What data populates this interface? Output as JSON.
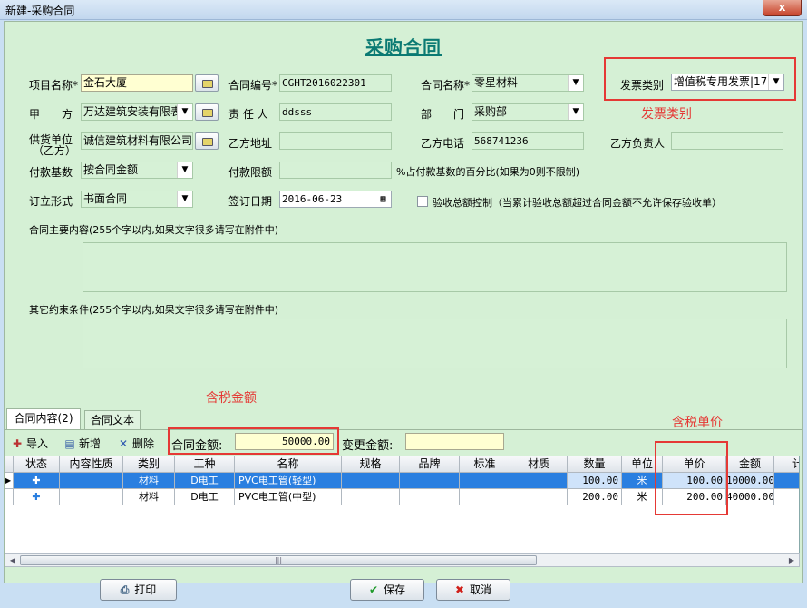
{
  "window": {
    "title": "新建-采购合同",
    "close_glyph": "x"
  },
  "heading": "采购合同",
  "form": {
    "project_label": "项目名称*",
    "project_value": "金石大厦",
    "contract_no_label": "合同编号*",
    "contract_no_value": "CGHT2016022301",
    "contract_name_label": "合同名称*",
    "contract_name_value": "零星材料",
    "invoice_label": "发票类别",
    "invoice_value": "增值税专用发票|17",
    "party_a_label": "甲　　方",
    "party_a_value": "万达建筑安装有限表",
    "responsible_label": "责 任 人",
    "responsible_value": "ddsss",
    "dept_label": "部　　门",
    "dept_value": "采购部",
    "supplier_label_1": "供货单位",
    "supplier_label_2": "（乙方）",
    "supplier_value": "诚信建筑材料有限公司",
    "party_b_addr_label": "乙方地址",
    "party_b_addr_value": "",
    "party_b_phone_label": "乙方电话",
    "party_b_phone_value": "568741236",
    "party_b_owner_label": "乙方负责人",
    "party_b_owner_value": "",
    "pay_base_label": "付款基数",
    "pay_base_value": "按合同金额",
    "pay_limit_label": "付款限额",
    "pay_limit_value": "",
    "pay_limit_hint": "%占付款基数的百分比(如果为0则不限制)",
    "form_type_label": "订立形式",
    "form_type_value": "书面合同",
    "sign_date_label": "签订日期",
    "sign_date_value": "2016-06-23",
    "acceptance_check_label": "验收总额控制（当累计验收总额超过合同金额不允许保存验收单）",
    "main_content_label": "合同主要内容(255个字以内,如果文字很多请写在附件中)",
    "other_terms_label": "其它约束条件(255个字以内,如果文字很多请写在附件中)"
  },
  "annotations": {
    "invoice": "发票类别",
    "tax_amount": "含税金额",
    "tax_price": "含税单价"
  },
  "tabs": [
    {
      "label": "合同内容(2)"
    },
    {
      "label": "合同文本"
    }
  ],
  "toolbar": {
    "import_label": "导入",
    "add_label": "新增",
    "delete_label": "删除",
    "amount_label": "合同金额:",
    "amount_value": "50000.00",
    "change_amount_label": "变更金额:",
    "change_amount_value": ""
  },
  "grid": {
    "columns": [
      "状态",
      "内容性质",
      "类别",
      "工种",
      "名称",
      "规格",
      "品牌",
      "标准",
      "材质",
      "数量",
      "单位",
      "单价",
      "金额",
      "计"
    ],
    "rows": [
      {
        "category": "材料",
        "trade": "D电工",
        "name": "PVC电工管(轻型)",
        "qty": "100.00",
        "unit": "米",
        "price": "100.00",
        "amount": "10000.00"
      },
      {
        "category": "材料",
        "trade": "D电工",
        "name": "PVC电工管(中型)",
        "qty": "200.00",
        "unit": "米",
        "price": "200.00",
        "amount": "40000.00"
      }
    ]
  },
  "buttons": {
    "print": "打印",
    "save": "保存",
    "cancel": "取消"
  },
  "colors": {
    "form_bg": "#d5f0d5",
    "heading": "#0b7a73",
    "annotation_red": "#e53935",
    "selected_row": "#2a7fe0"
  }
}
